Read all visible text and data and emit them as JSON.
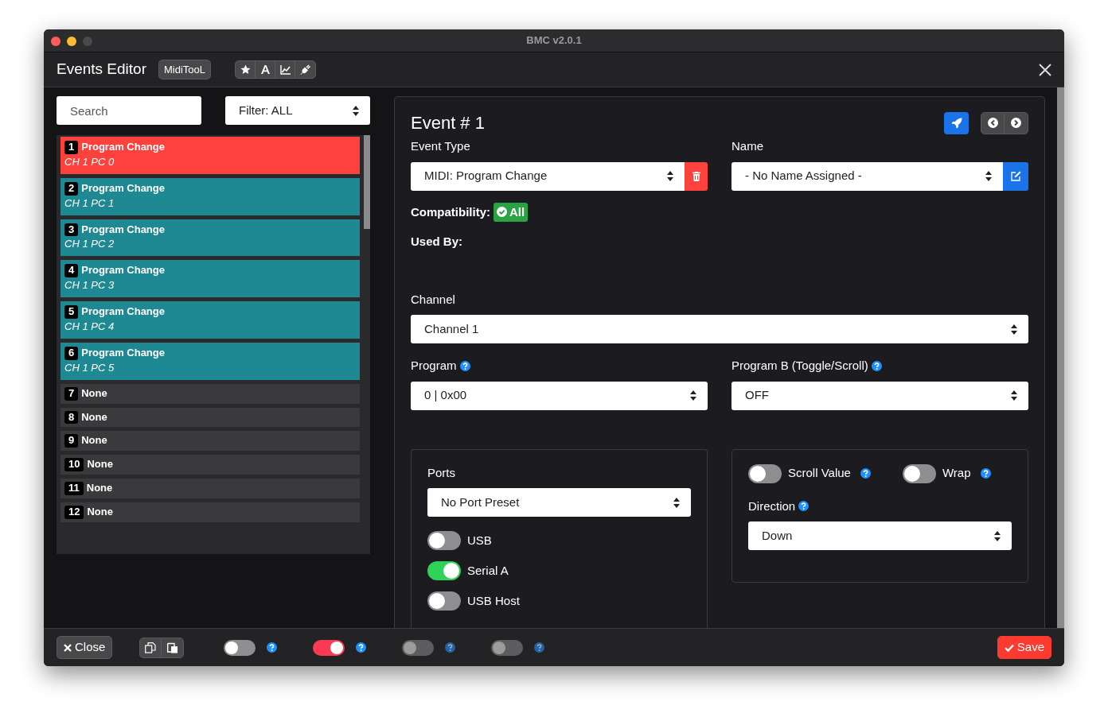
{
  "window": {
    "title": "BMC v2.0.1"
  },
  "header": {
    "title": "Events Editor",
    "badge": "MidiTooL"
  },
  "sidebar": {
    "search": {
      "placeholder": "Search"
    },
    "filter": "Filter: ALL",
    "events": [
      {
        "number": "1",
        "title": "Program Change",
        "detail": "CH 1 PC 0",
        "selected": true
      },
      {
        "number": "2",
        "title": "Program Change",
        "detail": "CH 1 PC 1",
        "selected": false,
        "color": "#1e8893"
      },
      {
        "number": "3",
        "title": "Program Change",
        "detail": "CH 1 PC 2",
        "selected": false,
        "color": "#1e8893"
      },
      {
        "number": "4",
        "title": "Program Change",
        "detail": "CH 1 PC 3",
        "selected": false,
        "color": "#1e8893"
      },
      {
        "number": "5",
        "title": "Program Change",
        "detail": "CH 1 PC 4",
        "selected": false,
        "color": "#1e8893"
      },
      {
        "number": "6",
        "title": "Program Change",
        "detail": "CH 1 PC 5",
        "selected": false,
        "color": "#1e8893"
      },
      {
        "number": "7",
        "title": "None",
        "selected": false,
        "color": "#3a3a3c"
      },
      {
        "number": "8",
        "title": "None",
        "selected": false,
        "color": "#3a3a3c"
      },
      {
        "number": "9",
        "title": "None",
        "selected": false,
        "color": "#3a3a3c"
      },
      {
        "number": "10",
        "title": "None",
        "selected": false,
        "color": "#3a3a3c"
      },
      {
        "number": "11",
        "title": "None",
        "selected": false,
        "color": "#3a3a3c"
      },
      {
        "number": "12",
        "title": "None",
        "selected": false,
        "color": "#3a3a3c"
      }
    ]
  },
  "event": {
    "heading": "Event # 1",
    "event_type": {
      "label": "Event Type",
      "value": "MIDI: Program Change"
    },
    "name": {
      "label": "Name",
      "value": "- No Name Assigned -"
    },
    "compatibility": {
      "label": "Compatibility:",
      "value": "All"
    },
    "used_by": {
      "label": "Used By:"
    },
    "channel": {
      "label": "Channel",
      "value": "Channel 1"
    },
    "program": {
      "label": "Program",
      "value": "0 | 0x00"
    },
    "program_b": {
      "label": "Program B (Toggle/Scroll)",
      "value": "OFF"
    },
    "ports": {
      "label": "Ports",
      "value": "No Port Preset",
      "switches": [
        {
          "label": "USB",
          "on": false
        },
        {
          "label": "Serial A",
          "on": true
        },
        {
          "label": "USB Host",
          "on": false
        }
      ]
    },
    "scroll": {
      "switches": [
        {
          "label": "Scroll Value",
          "on": false
        },
        {
          "label": "Wrap",
          "on": false
        }
      ],
      "direction": {
        "label": "Direction",
        "value": "Down"
      }
    }
  },
  "footer": {
    "close": "Close",
    "toggles": [
      {
        "on": false,
        "disabled": false
      },
      {
        "on": true,
        "disabled": false
      },
      {
        "on": false,
        "disabled": true
      },
      {
        "on": false,
        "disabled": true
      }
    ],
    "save": "Save"
  }
}
